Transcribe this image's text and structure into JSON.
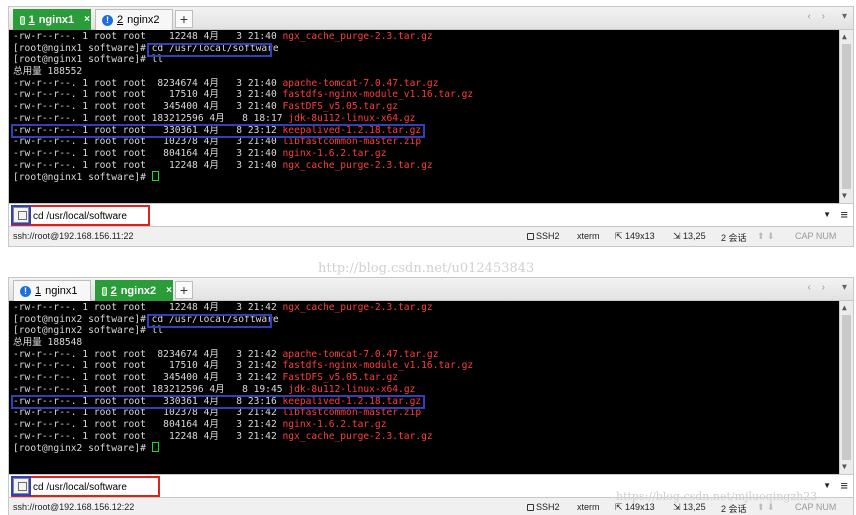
{
  "session1": {
    "tabs": [
      {
        "num": "1",
        "label": "nginx1",
        "active": true,
        "close": "×"
      },
      {
        "num": "2",
        "label": "nginx2",
        "active": false,
        "close": ""
      }
    ],
    "add_tab": "+",
    "nav_arrows": "‹ ›",
    "menu_arrow": "▾",
    "lines": [
      {
        "t": "-rw-r--r--. 1 root root    12248 4月   3 21:40 ",
        "f": "ngx_cache_purge-2.3.tar.gz"
      },
      {
        "t": "[root@nginx1 software]# cd /usr/local/software",
        "f": ""
      },
      {
        "t": "[root@nginx1 software]# ll",
        "f": ""
      },
      {
        "t": "总用量 188552",
        "f": ""
      },
      {
        "t": "-rw-r--r--. 1 root root  8234674 4月   3 21:40 ",
        "f": "apache-tomcat-7.0.47.tar.gz"
      },
      {
        "t": "-rw-r--r--. 1 root root    17510 4月   3 21:40 ",
        "f": "fastdfs-nginx-module_v1.16.tar.gz"
      },
      {
        "t": "-rw-r--r--. 1 root root   345400 4月   3 21:40 ",
        "f": "FastDFS_v5.05.tar.gz"
      },
      {
        "t": "-rw-r--r--. 1 root root 183212596 4月   8 18:17 ",
        "f": "jdk-8u112-linux-x64.gz"
      },
      {
        "t": "-rw-r--r--. 1 root root   330361 4月   8 23:12 ",
        "f": "keepalived-1.2.18.tar.gz"
      },
      {
        "t": "-rw-r--r--. 1 root root   102378 4月   3 21:40 ",
        "f": "libfastcommon-master.zip"
      },
      {
        "t": "-rw-r--r--. 1 root root   804164 4月   3 21:40 ",
        "f": "nginx-1.6.2.tar.gz"
      },
      {
        "t": "-rw-r--r--. 1 root root    12248 4月   3 21:40 ",
        "f": "ngx_cache_purge-2.3.tar.gz"
      },
      {
        "t": "[root@nginx1 software]# ",
        "f": "",
        "cursor": true
      }
    ],
    "command": "cd /usr/local/software",
    "status": {
      "host": "ssh://root@192.168.156.11:22",
      "proto": "SSH2",
      "term": "xterm",
      "size": "149x13",
      "pos": "13,25",
      "sessions": "2 会话",
      "caps": "CAP NUM"
    }
  },
  "session2": {
    "tabs": [
      {
        "num": "1",
        "label": "nginx1",
        "active": false,
        "close": ""
      },
      {
        "num": "2",
        "label": "nginx2",
        "active": true,
        "close": "×"
      }
    ],
    "add_tab": "+",
    "nav_arrows": "‹ ›",
    "menu_arrow": "▾",
    "lines": [
      {
        "t": "-rw-r--r--. 1 root root    12248 4月   3 21:42 ",
        "f": "ngx_cache_purge-2.3.tar.gz"
      },
      {
        "t": "[root@nginx2 software]# cd /usr/local/software",
        "f": ""
      },
      {
        "t": "[root@nginx2 software]# ll",
        "f": ""
      },
      {
        "t": "总用量 188548",
        "f": ""
      },
      {
        "t": "-rw-r--r--. 1 root root  8234674 4月   3 21:42 ",
        "f": "apache-tomcat-7.0.47.tar.gz"
      },
      {
        "t": "-rw-r--r--. 1 root root    17510 4月   3 21:42 ",
        "f": "fastdfs-nginx-module_v1.16.tar.gz"
      },
      {
        "t": "-rw-r--r--. 1 root root   345400 4月   3 21:42 ",
        "f": "FastDFS_v5.05.tar.gz"
      },
      {
        "t": "-rw-r--r--. 1 root root 183212596 4月   8 19:45 ",
        "f": "jdk-8u112-linux-x64.gz"
      },
      {
        "t": "-rw-r--r--. 1 root root   330361 4月   8 23:16 ",
        "f": "keepalived-1.2.18.tar.gz"
      },
      {
        "t": "-rw-r--r--. 1 root root   102378 4月   3 21:42 ",
        "f": "libfastcommon-master.zip"
      },
      {
        "t": "-rw-r--r--. 1 root root   804164 4月   3 21:42 ",
        "f": "nginx-1.6.2.tar.gz"
      },
      {
        "t": "-rw-r--r--. 1 root root    12248 4月   3 21:42 ",
        "f": "ngx_cache_purge-2.3.tar.gz"
      },
      {
        "t": "[root@nginx2 software]# ",
        "f": "",
        "cursor": true
      }
    ],
    "command": "cd /usr/local/software",
    "status": {
      "host": "ssh://root@192.168.156.12:22",
      "proto": "SSH2",
      "term": "xterm",
      "size": "149x13",
      "pos": "13,25",
      "sessions": "2 会话",
      "caps": "CAP NUM"
    }
  },
  "watermark_center": "http://blog.csdn.net/u012453843",
  "watermark_corner": "https://blog.csdn.net/mjluoqingzh23",
  "colors": {
    "accent_tab": "#2a9d3a",
    "highlight_blue": "#3140b8",
    "highlight_red": "#e0201c",
    "filename_red": "#ff3d3d"
  }
}
